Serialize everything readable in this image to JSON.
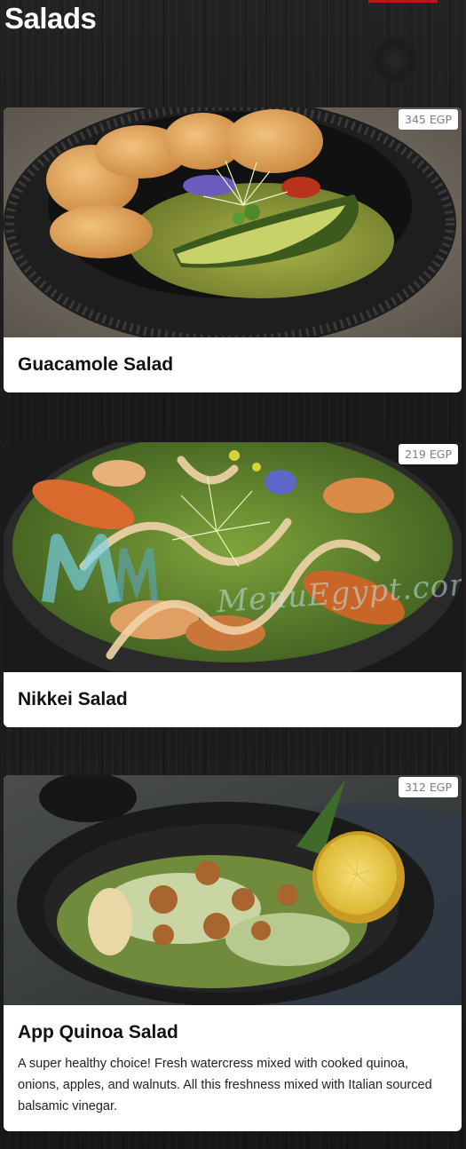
{
  "section": {
    "title": "Salads"
  },
  "items": [
    {
      "name": "Guacamole Salad",
      "price": "345 EGP",
      "description": ""
    },
    {
      "name": "Nikkei Salad",
      "price": "219 EGP",
      "description": ""
    },
    {
      "name": "App Quinoa Salad",
      "price": "312 EGP",
      "description": "A super healthy choice! Fresh watercress mixed with cooked quinoa, onions, apples, and walnuts. All this freshness mixed with Italian sourced balsamic vinegar."
    }
  ],
  "watermark": {
    "text": "MenuEgypt.com"
  },
  "colors": {
    "background": "#1c1c1c",
    "card": "#ffffff",
    "accent": "#c1121f",
    "price_text": "#8a7a7a"
  }
}
